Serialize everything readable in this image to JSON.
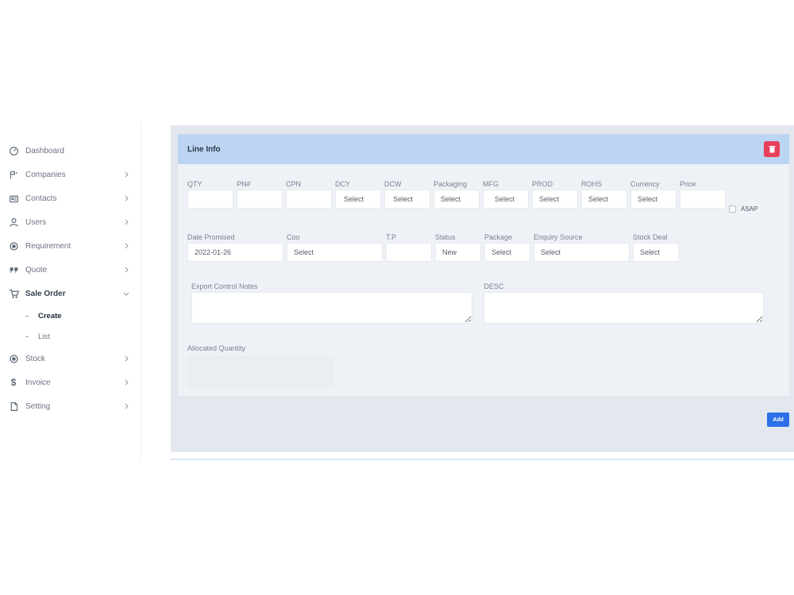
{
  "sidebar": {
    "items": [
      {
        "label": "Dashboard",
        "icon": "dashboard-icon",
        "has_chevron": false
      },
      {
        "label": "Companies",
        "icon": "companies-icon",
        "has_chevron": true
      },
      {
        "label": "Contacts",
        "icon": "contacts-icon",
        "has_chevron": true
      },
      {
        "label": "Users",
        "icon": "user-icon",
        "has_chevron": true
      },
      {
        "label": "Requirement",
        "icon": "requirement-icon",
        "has_chevron": true
      },
      {
        "label": "Quote",
        "icon": "quote-icon",
        "has_chevron": true
      },
      {
        "label": "Sale Order",
        "icon": "cart-icon",
        "has_chevron": true,
        "expanded": true
      }
    ],
    "sale_order_children": [
      {
        "label": "Create",
        "active": true
      },
      {
        "label": "List",
        "active": false
      }
    ],
    "items_after": [
      {
        "label": "Stock",
        "icon": "stock-icon",
        "has_chevron": true
      },
      {
        "label": "Invoice",
        "icon": "dollar-icon",
        "has_chevron": true
      },
      {
        "label": "Setting",
        "icon": "document-icon",
        "has_chevron": true
      }
    ]
  },
  "card": {
    "title": "Line Info",
    "row1": {
      "qty": {
        "label": "QTY",
        "value": ""
      },
      "pn": {
        "label": "PN#",
        "value": ""
      },
      "cpn": {
        "label": "CPN",
        "value": ""
      },
      "dcy": {
        "label": "DCY",
        "value": "Select"
      },
      "dcw": {
        "label": "DCW",
        "value": "Select"
      },
      "packaging": {
        "label": "Packaging",
        "value": "Select"
      },
      "mfg": {
        "label": "MFG",
        "value": "Select"
      },
      "prod": {
        "label": "PROD",
        "value": "Select"
      },
      "rohs": {
        "label": "ROHS",
        "value": "Select"
      },
      "currency": {
        "label": "Currency",
        "value": "Select"
      },
      "price": {
        "label": "Price",
        "value": ""
      },
      "asap_label": "ASAP"
    },
    "row2": {
      "date_promised": {
        "label": "Date Promised",
        "value": "2022-01-26"
      },
      "coo": {
        "label": "Coo",
        "value": "Select"
      },
      "tp": {
        "label": "T.P",
        "value": ""
      },
      "status": {
        "label": "Status",
        "value": "New"
      },
      "package": {
        "label": "Package",
        "value": "Select"
      },
      "enquiry_source": {
        "label": "Enquiry Source",
        "value": "Select"
      },
      "stock_deal": {
        "label": "Stock Deal",
        "value": "Select"
      }
    },
    "export_notes": {
      "label": "Export Control Notes",
      "value": ""
    },
    "desc": {
      "label": "DESC",
      "value": ""
    },
    "allocated_quantity": {
      "label": "Allocated Quantity"
    }
  },
  "add_button": {
    "label": "Add"
  },
  "colors": {
    "header_bg": "#bcd5f2",
    "delete_red": "#e8405b",
    "add_blue": "#2c6fe8",
    "main_bg": "#e3e8ef"
  }
}
